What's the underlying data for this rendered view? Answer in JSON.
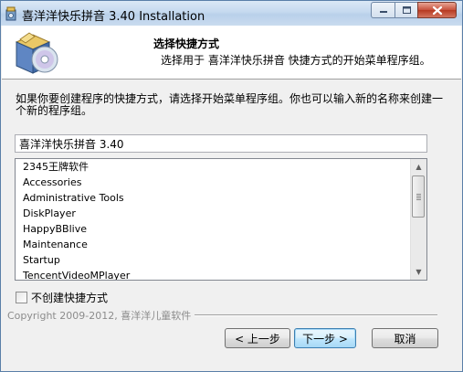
{
  "window": {
    "title": "喜洋洋快乐拼音 3.40 Installation"
  },
  "header": {
    "title": "选择快捷方式",
    "subtitle": "选择用于 喜洋洋快乐拼音 快捷方式的开始菜单程序组。",
    "logo_icon": "install-box-cd-icon"
  },
  "main": {
    "description": "如果你要创建程序的快捷方式，请选择开始菜单程序组。你也可以输入新的名称来创建一个新的程序组。",
    "folder_name_value": "喜洋洋快乐拼音 3.40",
    "folders": [
      "2345王牌软件",
      "Accessories",
      "Administrative Tools",
      "DiskPlayer",
      "HappyBBlive",
      "Maintenance",
      "Startup",
      "TencentVideoMPlayer"
    ],
    "no_shortcut_label": "不创建快捷方式",
    "no_shortcut_checked": false
  },
  "footer": {
    "copyright": "Copyright 2009-2012, 喜洋洋儿童软件",
    "back_label": "< 上一步",
    "next_label": "下一步 >",
    "cancel_label": "取消"
  }
}
